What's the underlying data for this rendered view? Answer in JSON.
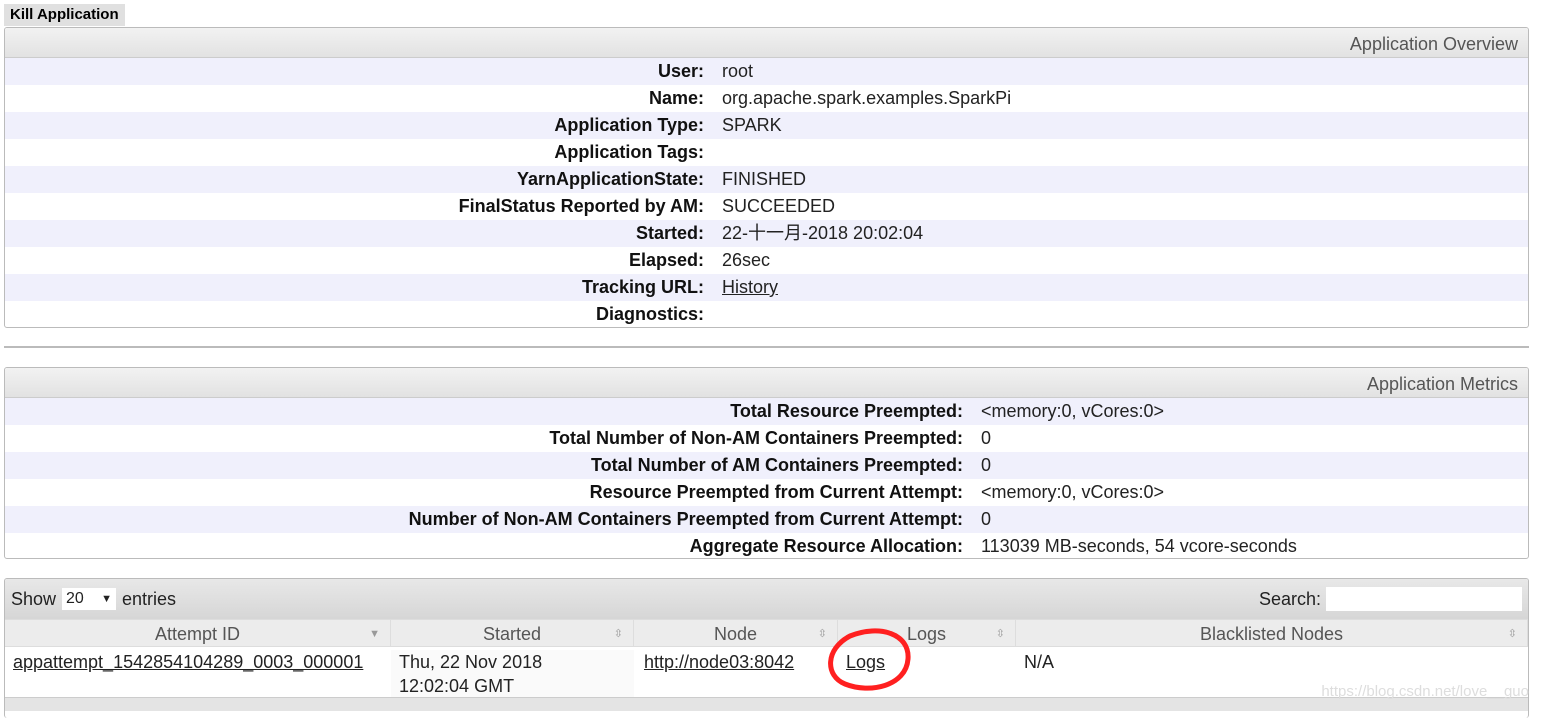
{
  "kill_label": "Kill Application",
  "overview": {
    "title": "Application Overview",
    "rows": [
      {
        "label": "User:",
        "value": "root"
      },
      {
        "label": "Name:",
        "value": "org.apache.spark.examples.SparkPi"
      },
      {
        "label": "Application Type:",
        "value": "SPARK"
      },
      {
        "label": "Application Tags:",
        "value": ""
      },
      {
        "label": "YarnApplicationState:",
        "value": "FINISHED"
      },
      {
        "label": "FinalStatus Reported by AM:",
        "value": "SUCCEEDED"
      },
      {
        "label": "Started:",
        "value": "22-十一月-2018 20:02:04"
      },
      {
        "label": "Elapsed:",
        "value": "26sec"
      },
      {
        "label": "Tracking URL:",
        "value": "History"
      },
      {
        "label": "Diagnostics:",
        "value": ""
      }
    ]
  },
  "metrics": {
    "title": "Application Metrics",
    "rows": [
      {
        "label": "Total Resource Preempted:",
        "value": "<memory:0, vCores:0>"
      },
      {
        "label": "Total Number of Non-AM Containers Preempted:",
        "value": "0"
      },
      {
        "label": "Total Number of AM Containers Preempted:",
        "value": "0"
      },
      {
        "label": "Resource Preempted from Current Attempt:",
        "value": "<memory:0, vCores:0>"
      },
      {
        "label": "Number of Non-AM Containers Preempted from Current Attempt:",
        "value": "0"
      },
      {
        "label": "Aggregate Resource Allocation:",
        "value": "113039 MB-seconds, 54 vcore-seconds"
      }
    ]
  },
  "table": {
    "show": "Show",
    "entries_value": "20",
    "entries": "entries",
    "search_label": "Search:",
    "search_value": "",
    "columns": [
      "Attempt ID",
      "Started",
      "Node",
      "Logs",
      "Blacklisted Nodes"
    ],
    "rows": [
      {
        "attempt": "appattempt_1542854104289_0003_000001",
        "started_1": "Thu, 22 Nov 2018",
        "started_2": "12:02:04 GMT",
        "node": "http://node03:8042",
        "logs": "Logs",
        "blacklisted": "N/A"
      }
    ]
  },
  "watermark": "https://blog.csdn.net/love__guo",
  "annotation_color": "#ff2020"
}
